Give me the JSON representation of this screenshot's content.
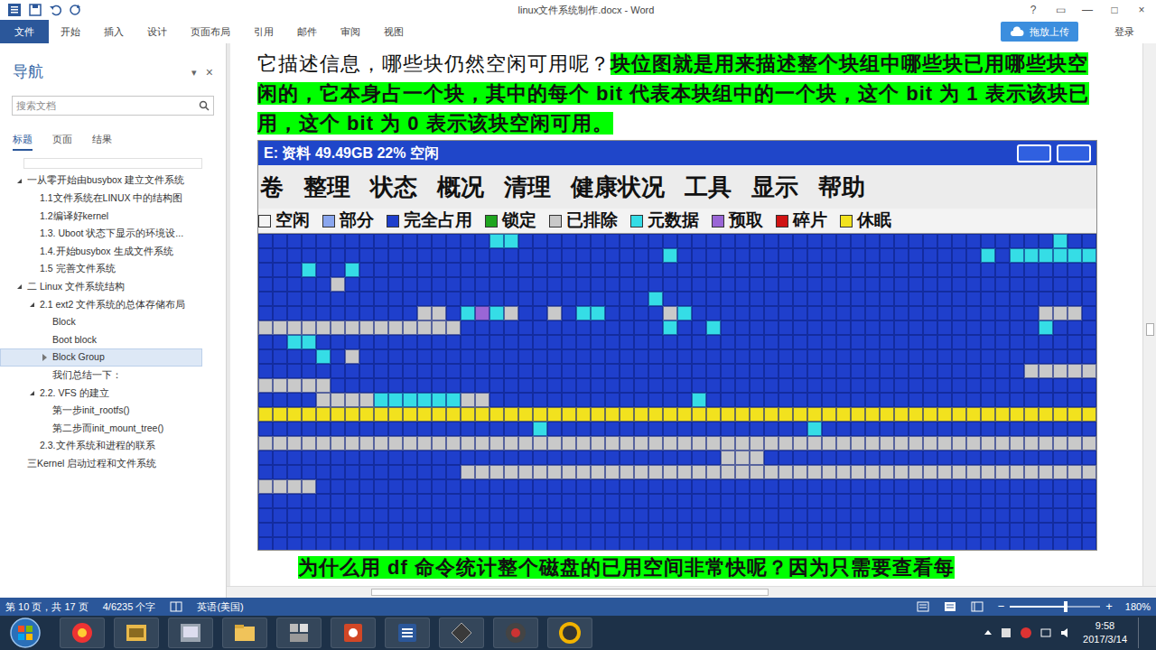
{
  "window": {
    "title": "linux文件系统制作.docx - Word",
    "controls": [
      "?",
      "▭",
      "—",
      "□",
      "×"
    ]
  },
  "ribbon": {
    "tabs": [
      {
        "label": "文件",
        "kind": "file"
      },
      {
        "label": "开始",
        "kind": "tab"
      },
      {
        "label": "插入",
        "kind": "tab"
      },
      {
        "label": "设计",
        "kind": "tab"
      },
      {
        "label": "页面布局",
        "kind": "tab"
      },
      {
        "label": "引用",
        "kind": "tab"
      },
      {
        "label": "邮件",
        "kind": "tab"
      },
      {
        "label": "审阅",
        "kind": "tab"
      },
      {
        "label": "视图",
        "kind": "tab"
      }
    ],
    "upload": "拖放上传",
    "login": "登录"
  },
  "nav": {
    "title": "导航",
    "menu": "▾",
    "close": "×",
    "search": {
      "placeholder": "搜索文档"
    },
    "tabs": [
      {
        "label": "标题",
        "selected": true
      },
      {
        "label": "页面",
        "selected": false
      },
      {
        "label": "结果",
        "selected": false
      }
    ],
    "items": [
      {
        "label": "一从零开始由busybox 建立文件系统",
        "level": 0,
        "has_children": true,
        "expanded": true,
        "selected": false
      },
      {
        "label": "1.1文件系统在LINUX 中的结构图",
        "level": 1,
        "has_children": false,
        "expanded": false,
        "selected": false
      },
      {
        "label": "1.2编译好kernel",
        "level": 1,
        "has_children": false,
        "expanded": false,
        "selected": false
      },
      {
        "label": "1.3. Uboot 状态下显示的环境设...",
        "level": 1,
        "has_children": false,
        "expanded": false,
        "selected": false
      },
      {
        "label": "1.4.开始busybox 生成文件系统",
        "level": 1,
        "has_children": false,
        "expanded": false,
        "selected": false
      },
      {
        "label": "1.5 完善文件系统",
        "level": 1,
        "has_children": false,
        "expanded": false,
        "selected": false
      },
      {
        "label": "二 Linux 文件系统结构",
        "level": 0,
        "has_children": true,
        "expanded": true,
        "selected": false
      },
      {
        "label": "2.1 ext2 文件系统的总体存储布局",
        "level": 1,
        "has_children": true,
        "expanded": true,
        "selected": false
      },
      {
        "label": "Block",
        "level": 2,
        "has_children": false,
        "expanded": false,
        "selected": false
      },
      {
        "label": "Boot block",
        "level": 2,
        "has_children": false,
        "expanded": false,
        "selected": false
      },
      {
        "label": "Block Group",
        "level": 2,
        "has_children": true,
        "expanded": false,
        "selected": true
      },
      {
        "label": "我们总结一下：",
        "level": 2,
        "has_children": false,
        "expanded": false,
        "selected": false
      },
      {
        "label": "2.2. VFS 的建立",
        "level": 1,
        "has_children": true,
        "expanded": true,
        "selected": false
      },
      {
        "label": "第一步init_rootfs()",
        "level": 2,
        "has_children": false,
        "expanded": false,
        "selected": false
      },
      {
        "label": "第二步而init_mount_tree()",
        "level": 2,
        "has_children": false,
        "expanded": false,
        "selected": false
      },
      {
        "label": "2.3.文件系统和进程的联系",
        "level": 1,
        "has_children": false,
        "expanded": false,
        "selected": false
      },
      {
        "label": "三Kernel 启动过程和文件系统",
        "level": 0,
        "has_children": false,
        "expanded": false,
        "selected": false
      }
    ]
  },
  "document": {
    "paragraphs": [
      {
        "runs": [
          {
            "text": "它描述信息，哪些块仍然空闲可用呢？",
            "highlight": false
          },
          {
            "text": "块位图就是用来描述整个块组中哪些块已用哪些块空闲的，它本身占一个块，其中的每个 bit  代表本块组中的一个块，这个 bit  为 1  表示该块已用，这个 bit  为 0  表示该块空闲可用。",
            "highlight": true
          }
        ]
      }
    ],
    "figure": {
      "status_text": "E: 资料   49.49GB 22% 空闲",
      "menu": [
        "卷",
        "整理",
        "状态",
        "概况",
        "清理",
        "健康状况",
        "工具",
        "显示",
        "帮助"
      ],
      "legend": [
        {
          "label": "空闲",
          "color": "#f4f4f4"
        },
        {
          "label": "部分",
          "color": "#8aa6ee"
        },
        {
          "label": "完全占用",
          "color": "#1f3fcc"
        },
        {
          "label": "锁定",
          "color": "#1fa51f"
        },
        {
          "label": "已排除",
          "color": "#c9c9c9"
        },
        {
          "label": "元数据",
          "color": "#35dde6"
        },
        {
          "label": "预取",
          "color": "#9a66d6"
        },
        {
          "label": "碎片",
          "color": "#d01414"
        },
        {
          "label": "休眠",
          "color": "#f2e21e"
        }
      ],
      "grid": [
        "2222222222222222552222222222222222222222222222222222222522",
        "2222222222222222222222222222522222222222222222222252555555",
        "2225225222222222222222222222222222222222222222222222222222",
        "2222242222222222222222222222222222222222222222222222222222",
        "2222222222222222222222222225222222222222222222222222222222",
        "2222222222244256542242552222452222222222222222222222224442",
        "4444444444444422222222222222522522222222222222222222225222",
        "2255222222222222222222222222222222222222222222222222222222",
        "2222524222222222222222222222222222222222222222222222222222",
        "2222222222222222222222222222222222222222222222222222244444",
        "4444422222222222222222222222222222222222222222222222222222",
        "2222444455555544222222222222225222222222222222222222222222",
        "8888888888888888888888888888888888888888888888888888888888",
        "2222222222222222222522222222222222222252222222222222222222",
        "4444444444444444444444444444444444444444444444444444444444",
        "2222222222222222222222222222222244422222222222222222222222",
        "2222222222222244444444444444444444444444444444444444444444",
        "4444222222222222222222222222222222222222222222222222222222",
        "2222222222222222222222222222222222222222222222222222222222",
        "2222222222222222222222222222222222222222222222222222222222",
        "2222222222222222222222222222222222222222222222222222222222",
        "2222222222222222222222222222222222222222222222222222222222"
      ]
    },
    "caption": {
      "text": "为什么用 df  命令统计整个磁盘的已用空间非常快呢？因为只需要查看每",
      "highlight": true
    }
  },
  "status_bar": {
    "page": "第 10 页，共 17 页",
    "words": "4/6235 个字",
    "language": "英语(美国)",
    "zoom": {
      "minus": "−",
      "plus": "+",
      "reading": "180%",
      "level": 0.62
    }
  },
  "taskbar": {
    "time": "9:58",
    "date": "2017/3/14"
  }
}
